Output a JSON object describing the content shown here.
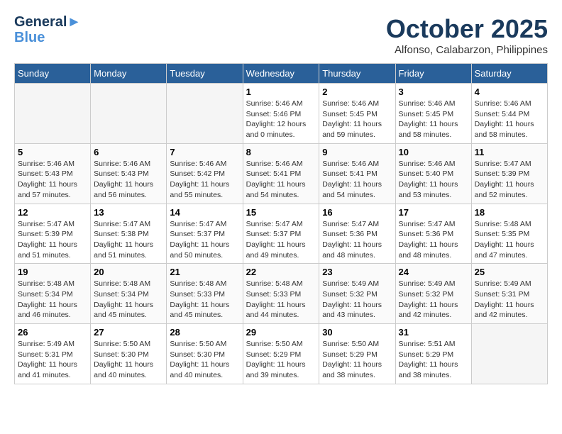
{
  "header": {
    "logo_line1": "General",
    "logo_line2": "Blue",
    "month": "October 2025",
    "location": "Alfonso, Calabarzon, Philippines"
  },
  "weekdays": [
    "Sunday",
    "Monday",
    "Tuesday",
    "Wednesday",
    "Thursday",
    "Friday",
    "Saturday"
  ],
  "weeks": [
    [
      {
        "day": "",
        "info": ""
      },
      {
        "day": "",
        "info": ""
      },
      {
        "day": "",
        "info": ""
      },
      {
        "day": "1",
        "info": "Sunrise: 5:46 AM\nSunset: 5:46 PM\nDaylight: 12 hours\nand 0 minutes."
      },
      {
        "day": "2",
        "info": "Sunrise: 5:46 AM\nSunset: 5:45 PM\nDaylight: 11 hours\nand 59 minutes."
      },
      {
        "day": "3",
        "info": "Sunrise: 5:46 AM\nSunset: 5:45 PM\nDaylight: 11 hours\nand 58 minutes."
      },
      {
        "day": "4",
        "info": "Sunrise: 5:46 AM\nSunset: 5:44 PM\nDaylight: 11 hours\nand 58 minutes."
      }
    ],
    [
      {
        "day": "5",
        "info": "Sunrise: 5:46 AM\nSunset: 5:43 PM\nDaylight: 11 hours\nand 57 minutes."
      },
      {
        "day": "6",
        "info": "Sunrise: 5:46 AM\nSunset: 5:43 PM\nDaylight: 11 hours\nand 56 minutes."
      },
      {
        "day": "7",
        "info": "Sunrise: 5:46 AM\nSunset: 5:42 PM\nDaylight: 11 hours\nand 55 minutes."
      },
      {
        "day": "8",
        "info": "Sunrise: 5:46 AM\nSunset: 5:41 PM\nDaylight: 11 hours\nand 54 minutes."
      },
      {
        "day": "9",
        "info": "Sunrise: 5:46 AM\nSunset: 5:41 PM\nDaylight: 11 hours\nand 54 minutes."
      },
      {
        "day": "10",
        "info": "Sunrise: 5:46 AM\nSunset: 5:40 PM\nDaylight: 11 hours\nand 53 minutes."
      },
      {
        "day": "11",
        "info": "Sunrise: 5:47 AM\nSunset: 5:39 PM\nDaylight: 11 hours\nand 52 minutes."
      }
    ],
    [
      {
        "day": "12",
        "info": "Sunrise: 5:47 AM\nSunset: 5:39 PM\nDaylight: 11 hours\nand 51 minutes."
      },
      {
        "day": "13",
        "info": "Sunrise: 5:47 AM\nSunset: 5:38 PM\nDaylight: 11 hours\nand 51 minutes."
      },
      {
        "day": "14",
        "info": "Sunrise: 5:47 AM\nSunset: 5:37 PM\nDaylight: 11 hours\nand 50 minutes."
      },
      {
        "day": "15",
        "info": "Sunrise: 5:47 AM\nSunset: 5:37 PM\nDaylight: 11 hours\nand 49 minutes."
      },
      {
        "day": "16",
        "info": "Sunrise: 5:47 AM\nSunset: 5:36 PM\nDaylight: 11 hours\nand 48 minutes."
      },
      {
        "day": "17",
        "info": "Sunrise: 5:47 AM\nSunset: 5:36 PM\nDaylight: 11 hours\nand 48 minutes."
      },
      {
        "day": "18",
        "info": "Sunrise: 5:48 AM\nSunset: 5:35 PM\nDaylight: 11 hours\nand 47 minutes."
      }
    ],
    [
      {
        "day": "19",
        "info": "Sunrise: 5:48 AM\nSunset: 5:34 PM\nDaylight: 11 hours\nand 46 minutes."
      },
      {
        "day": "20",
        "info": "Sunrise: 5:48 AM\nSunset: 5:34 PM\nDaylight: 11 hours\nand 45 minutes."
      },
      {
        "day": "21",
        "info": "Sunrise: 5:48 AM\nSunset: 5:33 PM\nDaylight: 11 hours\nand 45 minutes."
      },
      {
        "day": "22",
        "info": "Sunrise: 5:48 AM\nSunset: 5:33 PM\nDaylight: 11 hours\nand 44 minutes."
      },
      {
        "day": "23",
        "info": "Sunrise: 5:49 AM\nSunset: 5:32 PM\nDaylight: 11 hours\nand 43 minutes."
      },
      {
        "day": "24",
        "info": "Sunrise: 5:49 AM\nSunset: 5:32 PM\nDaylight: 11 hours\nand 42 minutes."
      },
      {
        "day": "25",
        "info": "Sunrise: 5:49 AM\nSunset: 5:31 PM\nDaylight: 11 hours\nand 42 minutes."
      }
    ],
    [
      {
        "day": "26",
        "info": "Sunrise: 5:49 AM\nSunset: 5:31 PM\nDaylight: 11 hours\nand 41 minutes."
      },
      {
        "day": "27",
        "info": "Sunrise: 5:50 AM\nSunset: 5:30 PM\nDaylight: 11 hours\nand 40 minutes."
      },
      {
        "day": "28",
        "info": "Sunrise: 5:50 AM\nSunset: 5:30 PM\nDaylight: 11 hours\nand 40 minutes."
      },
      {
        "day": "29",
        "info": "Sunrise: 5:50 AM\nSunset: 5:29 PM\nDaylight: 11 hours\nand 39 minutes."
      },
      {
        "day": "30",
        "info": "Sunrise: 5:50 AM\nSunset: 5:29 PM\nDaylight: 11 hours\nand 38 minutes."
      },
      {
        "day": "31",
        "info": "Sunrise: 5:51 AM\nSunset: 5:29 PM\nDaylight: 11 hours\nand 38 minutes."
      },
      {
        "day": "",
        "info": ""
      }
    ]
  ]
}
